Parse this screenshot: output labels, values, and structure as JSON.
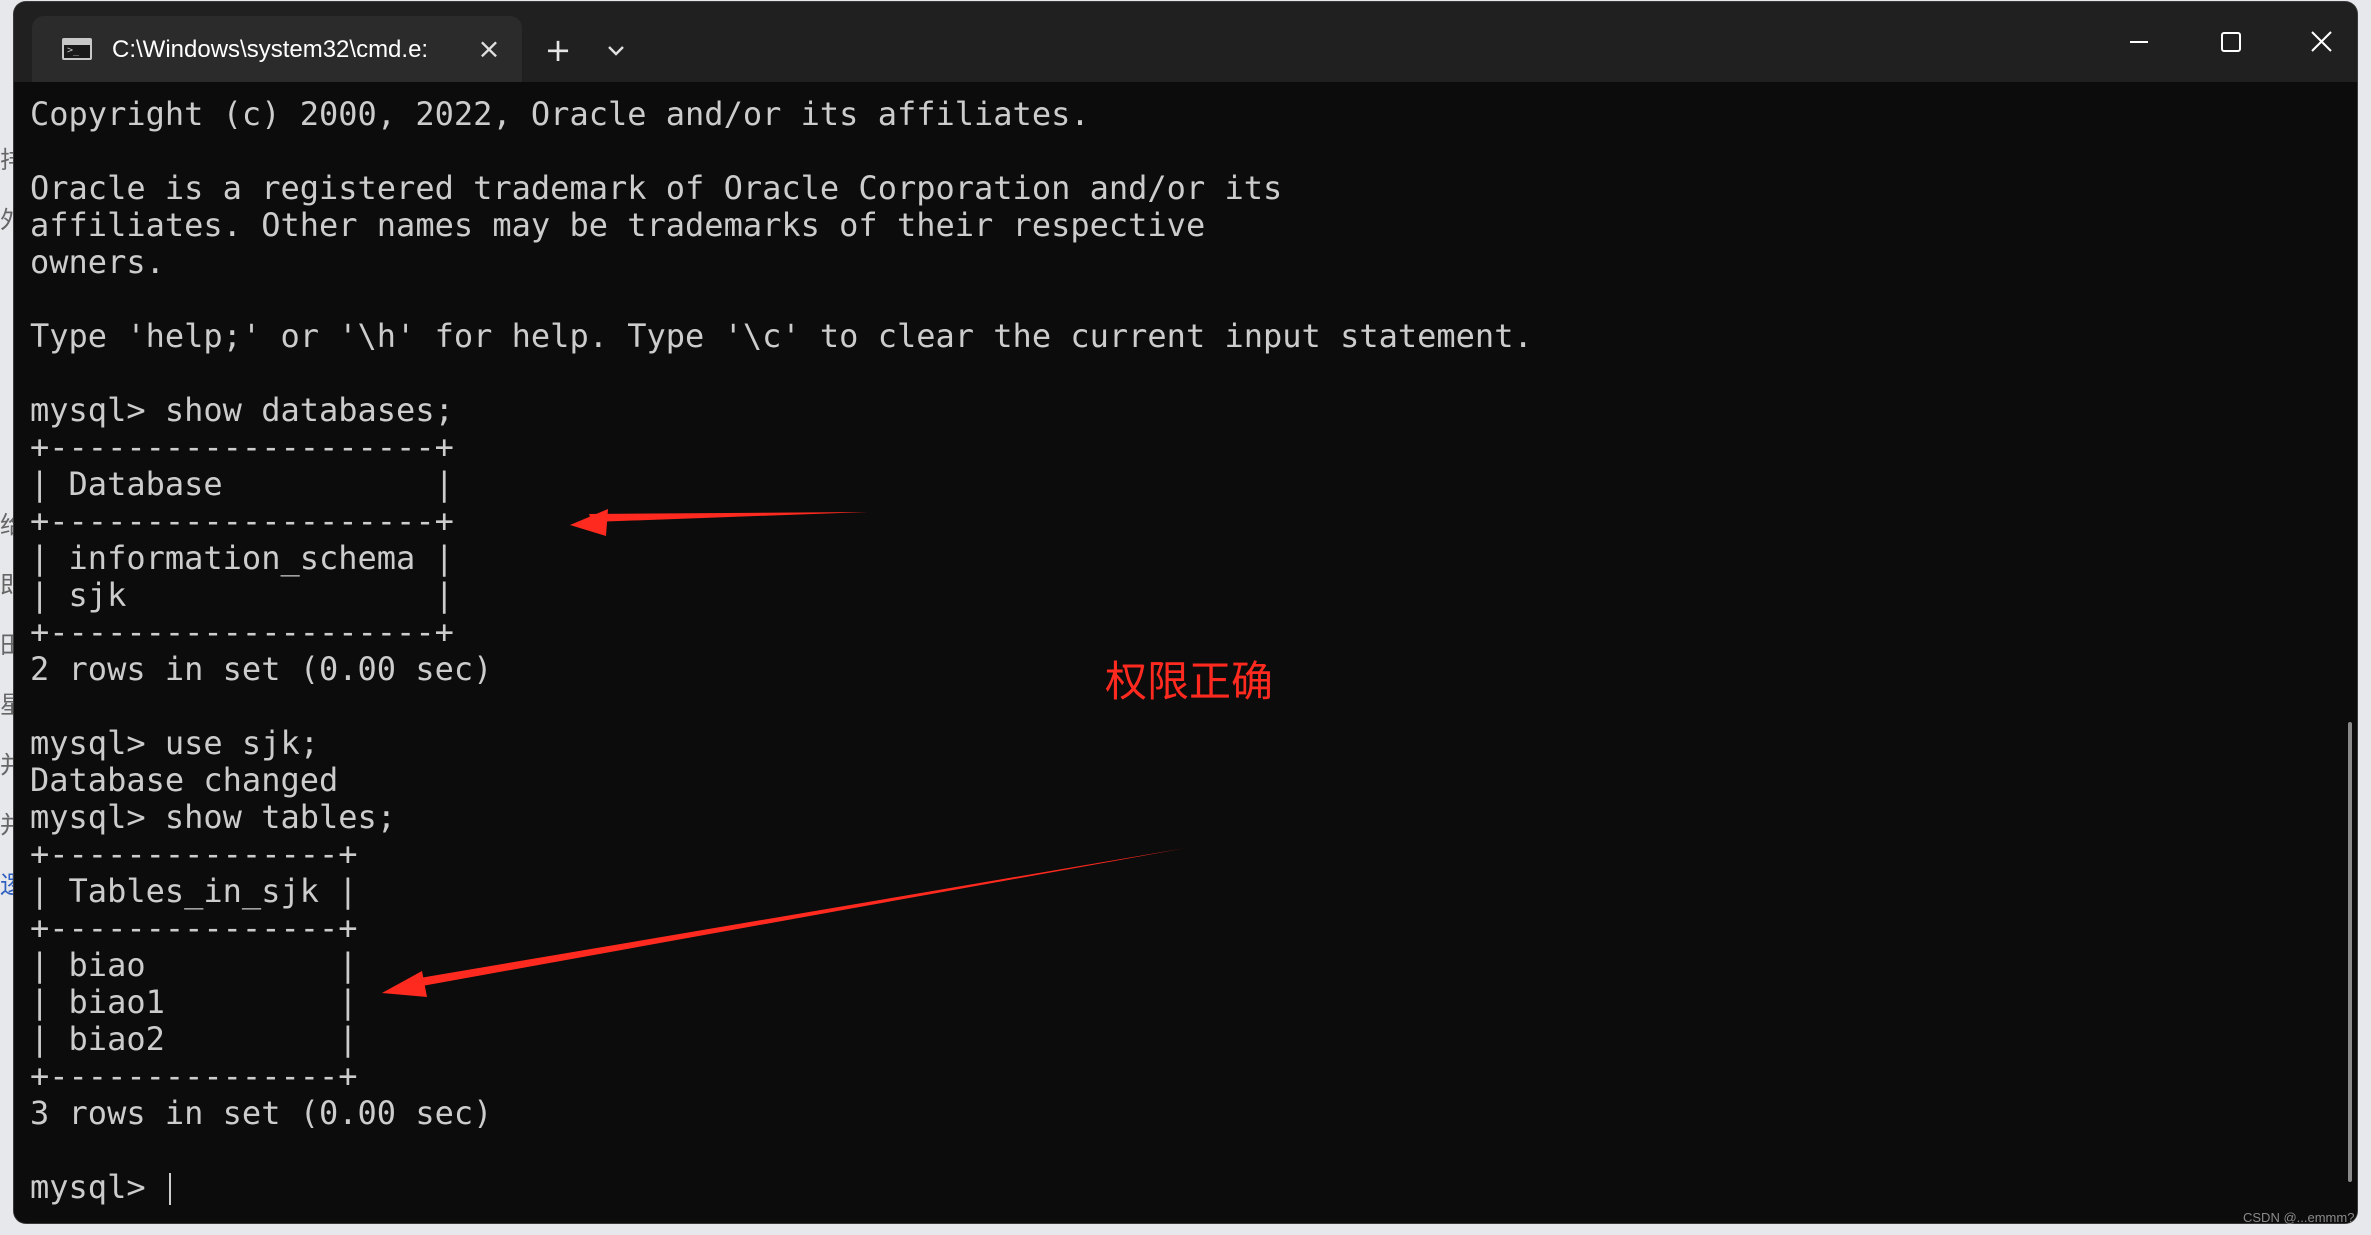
{
  "window": {
    "tab_title": "C:\\Windows\\system32\\cmd.e:",
    "tab_icon": "terminal-icon",
    "controls": [
      "minimize-icon",
      "maximize-icon",
      "close-icon"
    ]
  },
  "console": {
    "lines": [
      "Copyright (c) 2000, 2022, Oracle and/or its affiliates.",
      "",
      "Oracle is a registered trademark of Oracle Corporation and/or its",
      "affiliates. Other names may be trademarks of their respective",
      "owners.",
      "",
      "Type 'help;' or '\\h' for help. Type '\\c' to clear the current input statement.",
      "",
      "mysql> show databases;",
      "+--------------------+",
      "| Database           |",
      "+--------------------+",
      "| information_schema |",
      "| sjk                |",
      "+--------------------+",
      "2 rows in set (0.00 sec)",
      "",
      "mysql> use sjk;",
      "Database changed",
      "mysql> show tables;",
      "+---------------+",
      "| Tables_in_sjk |",
      "+---------------+",
      "| biao          |",
      "| biao1         |",
      "| biao2         |",
      "+---------------+",
      "3 rows in set (0.00 sec)",
      "",
      "mysql> "
    ]
  },
  "annotation": {
    "text": "权限正确",
    "color": "#ff2a1f"
  },
  "watermark": "CSDN @...emmm?",
  "colors": {
    "console_bg": "#0c0c0c",
    "console_fg": "#cccccc",
    "titlebar_bg": "#202020",
    "tab_bg": "#2b2b2b"
  }
}
